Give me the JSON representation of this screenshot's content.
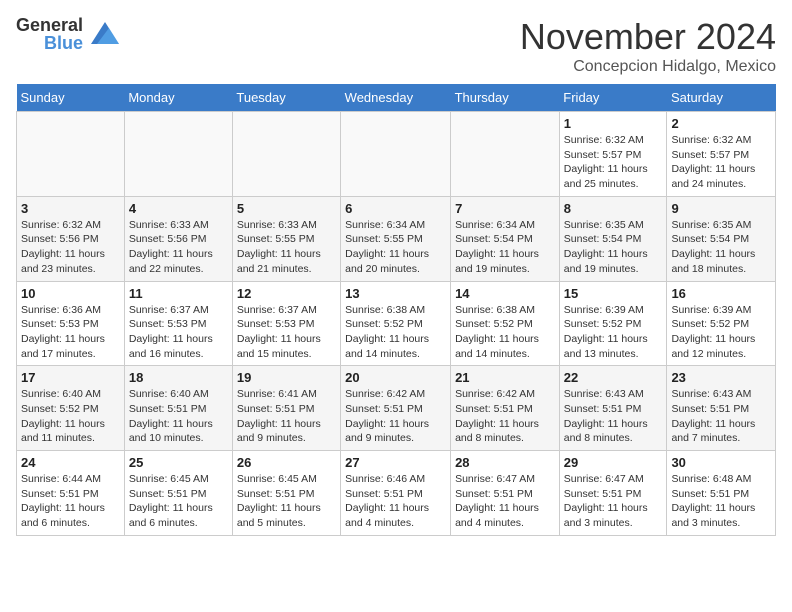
{
  "logo": {
    "text_general": "General",
    "text_blue": "Blue"
  },
  "title": "November 2024",
  "location": "Concepcion Hidalgo, Mexico",
  "days_of_week": [
    "Sunday",
    "Monday",
    "Tuesday",
    "Wednesday",
    "Thursday",
    "Friday",
    "Saturday"
  ],
  "weeks": [
    [
      {
        "day": "",
        "info": ""
      },
      {
        "day": "",
        "info": ""
      },
      {
        "day": "",
        "info": ""
      },
      {
        "day": "",
        "info": ""
      },
      {
        "day": "",
        "info": ""
      },
      {
        "day": "1",
        "info": "Sunrise: 6:32 AM\nSunset: 5:57 PM\nDaylight: 11 hours and 25 minutes."
      },
      {
        "day": "2",
        "info": "Sunrise: 6:32 AM\nSunset: 5:57 PM\nDaylight: 11 hours and 24 minutes."
      }
    ],
    [
      {
        "day": "3",
        "info": "Sunrise: 6:32 AM\nSunset: 5:56 PM\nDaylight: 11 hours and 23 minutes."
      },
      {
        "day": "4",
        "info": "Sunrise: 6:33 AM\nSunset: 5:56 PM\nDaylight: 11 hours and 22 minutes."
      },
      {
        "day": "5",
        "info": "Sunrise: 6:33 AM\nSunset: 5:55 PM\nDaylight: 11 hours and 21 minutes."
      },
      {
        "day": "6",
        "info": "Sunrise: 6:34 AM\nSunset: 5:55 PM\nDaylight: 11 hours and 20 minutes."
      },
      {
        "day": "7",
        "info": "Sunrise: 6:34 AM\nSunset: 5:54 PM\nDaylight: 11 hours and 19 minutes."
      },
      {
        "day": "8",
        "info": "Sunrise: 6:35 AM\nSunset: 5:54 PM\nDaylight: 11 hours and 19 minutes."
      },
      {
        "day": "9",
        "info": "Sunrise: 6:35 AM\nSunset: 5:54 PM\nDaylight: 11 hours and 18 minutes."
      }
    ],
    [
      {
        "day": "10",
        "info": "Sunrise: 6:36 AM\nSunset: 5:53 PM\nDaylight: 11 hours and 17 minutes."
      },
      {
        "day": "11",
        "info": "Sunrise: 6:37 AM\nSunset: 5:53 PM\nDaylight: 11 hours and 16 minutes."
      },
      {
        "day": "12",
        "info": "Sunrise: 6:37 AM\nSunset: 5:53 PM\nDaylight: 11 hours and 15 minutes."
      },
      {
        "day": "13",
        "info": "Sunrise: 6:38 AM\nSunset: 5:52 PM\nDaylight: 11 hours and 14 minutes."
      },
      {
        "day": "14",
        "info": "Sunrise: 6:38 AM\nSunset: 5:52 PM\nDaylight: 11 hours and 14 minutes."
      },
      {
        "day": "15",
        "info": "Sunrise: 6:39 AM\nSunset: 5:52 PM\nDaylight: 11 hours and 13 minutes."
      },
      {
        "day": "16",
        "info": "Sunrise: 6:39 AM\nSunset: 5:52 PM\nDaylight: 11 hours and 12 minutes."
      }
    ],
    [
      {
        "day": "17",
        "info": "Sunrise: 6:40 AM\nSunset: 5:52 PM\nDaylight: 11 hours and 11 minutes."
      },
      {
        "day": "18",
        "info": "Sunrise: 6:40 AM\nSunset: 5:51 PM\nDaylight: 11 hours and 10 minutes."
      },
      {
        "day": "19",
        "info": "Sunrise: 6:41 AM\nSunset: 5:51 PM\nDaylight: 11 hours and 9 minutes."
      },
      {
        "day": "20",
        "info": "Sunrise: 6:42 AM\nSunset: 5:51 PM\nDaylight: 11 hours and 9 minutes."
      },
      {
        "day": "21",
        "info": "Sunrise: 6:42 AM\nSunset: 5:51 PM\nDaylight: 11 hours and 8 minutes."
      },
      {
        "day": "22",
        "info": "Sunrise: 6:43 AM\nSunset: 5:51 PM\nDaylight: 11 hours and 8 minutes."
      },
      {
        "day": "23",
        "info": "Sunrise: 6:43 AM\nSunset: 5:51 PM\nDaylight: 11 hours and 7 minutes."
      }
    ],
    [
      {
        "day": "24",
        "info": "Sunrise: 6:44 AM\nSunset: 5:51 PM\nDaylight: 11 hours and 6 minutes."
      },
      {
        "day": "25",
        "info": "Sunrise: 6:45 AM\nSunset: 5:51 PM\nDaylight: 11 hours and 6 minutes."
      },
      {
        "day": "26",
        "info": "Sunrise: 6:45 AM\nSunset: 5:51 PM\nDaylight: 11 hours and 5 minutes."
      },
      {
        "day": "27",
        "info": "Sunrise: 6:46 AM\nSunset: 5:51 PM\nDaylight: 11 hours and 4 minutes."
      },
      {
        "day": "28",
        "info": "Sunrise: 6:47 AM\nSunset: 5:51 PM\nDaylight: 11 hours and 4 minutes."
      },
      {
        "day": "29",
        "info": "Sunrise: 6:47 AM\nSunset: 5:51 PM\nDaylight: 11 hours and 3 minutes."
      },
      {
        "day": "30",
        "info": "Sunrise: 6:48 AM\nSunset: 5:51 PM\nDaylight: 11 hours and 3 minutes."
      }
    ]
  ]
}
